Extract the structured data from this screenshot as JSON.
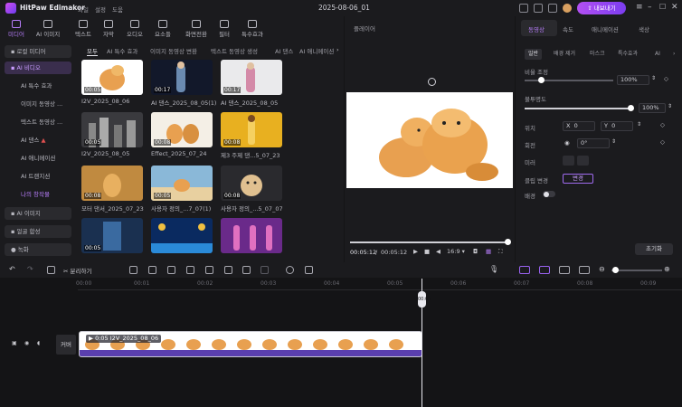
{
  "app": {
    "name": "HitPaw Edimakor",
    "menus": [
      "파일",
      "설정",
      "도움"
    ],
    "doc_title": "2025-08-06_01",
    "export_label": "내보내기"
  },
  "toolbar": {
    "tools": [
      "미디어",
      "AI 이미지",
      "텍스트",
      "자막",
      "오디오",
      "요소들",
      "화면전환",
      "필터",
      "특수효과"
    ]
  },
  "sidebar": {
    "items": [
      "로컬 미디어",
      "AI 비디오",
      "AI 특수 효과",
      "이미지 동영상 ...",
      "텍스트 동영상 ...",
      "AI 댄스",
      "AI 애니메이션",
      "AI 트랜지션",
      "나의 창작물",
      "AI 이미지",
      "얼굴 합성",
      "녹화"
    ]
  },
  "media": {
    "filter_tabs": [
      "모두",
      "AI 특수 효과",
      "이미지 동영상 변환",
      "텍스트 동영상 생성",
      "AI 댄스",
      "AI 애니메이션"
    ],
    "items": [
      {
        "duration": "00:05",
        "label": "I2V_2025_08_06"
      },
      {
        "duration": "00:17",
        "label": "AI 댄스_2025_08_05(1)"
      },
      {
        "duration": "00:17",
        "label": "AI 댄스_2025_08_05"
      },
      {
        "duration": "00:05",
        "label": "I2V_2025_08_05"
      },
      {
        "duration": "00:08",
        "label": "Effect_2025_07_24"
      },
      {
        "duration": "00:08",
        "label": "제3 주제 댄...5_07_23"
      },
      {
        "duration": "00:08",
        "label": "모터 댄서_2025_07_23"
      },
      {
        "duration": "00:05",
        "label": "사용자 정의_...7_07(1)"
      },
      {
        "duration": "00:08",
        "label": "사용자 정의_...5_07_07"
      },
      {
        "duration": "00:05",
        "label": ""
      },
      {
        "duration": "",
        "label": ""
      },
      {
        "duration": "",
        "label": ""
      }
    ]
  },
  "player": {
    "header": "플레이어",
    "current_time": "00:05:12",
    "total_time": "00:05:12",
    "aspect": "16:9"
  },
  "props": {
    "tabs": [
      "동영상",
      "속도",
      "애니메이션",
      "색상"
    ],
    "subtabs": [
      "일반",
      "배경 제거",
      "마스크",
      "특수효과",
      "AI"
    ],
    "scale_label": "비율 조정",
    "scale_value": "100%",
    "opacity_label": "불투명도",
    "opacity_value": "100%",
    "position_label": "위치",
    "pos_x_label": "X",
    "pos_x": "0",
    "pos_y_label": "Y",
    "pos_y": "0",
    "rotate_label": "회전",
    "rotate_value": "0°",
    "mirror_label": "미러",
    "clip_change_label": "클립 변경",
    "change_btn": "변경",
    "background_label": "배경",
    "reset_btn": "초기화"
  },
  "timeline_toolbar": {
    "split_label": "분리하기"
  },
  "timeline": {
    "ruler": [
      "00:00",
      "00:01",
      "00:02",
      "00:03",
      "00:04",
      "00:05",
      "00:06",
      "00:07",
      "00:08",
      "00:09"
    ],
    "playhead_time": "00:05",
    "clip_duration": "0:05",
    "clip_name": "I2V_2025_08_06",
    "cover_label": "커버"
  },
  "colors": {
    "accent": "#b57cf7",
    "export_start": "#b350f2",
    "export_end": "#7b3df0",
    "track": "#5a3fae"
  }
}
